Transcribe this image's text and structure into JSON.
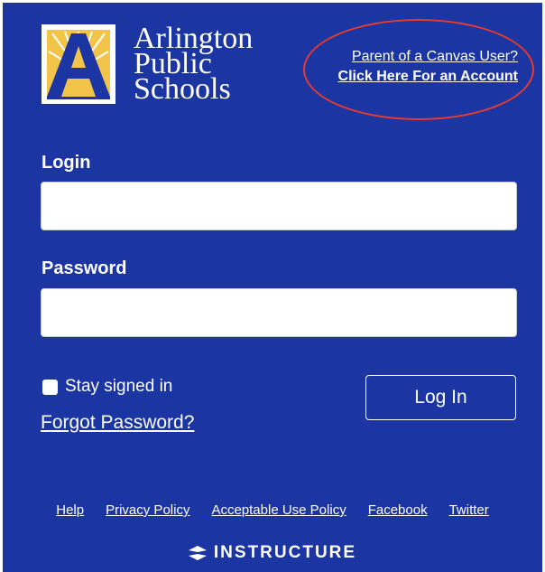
{
  "logo": {
    "line1": "Arlington",
    "line2": "Public",
    "line3": "Schools",
    "icon": "arlington-a-sunburst-logo",
    "colors": {
      "mark_yellow": "#f3c44a",
      "mark_blue": "#1b35a3"
    }
  },
  "parent": {
    "line1": "Parent of a Canvas User?",
    "line2": "Click Here For an Account",
    "highlight_color": "#e63a2e"
  },
  "form": {
    "login_label": "Login",
    "login_value": "",
    "password_label": "Password",
    "password_value": "",
    "stay_signed_in": "Stay signed in",
    "stay_signed_in_checked": false,
    "forgot_password": "Forgot Password?",
    "login_button": "Log In"
  },
  "footer": {
    "links": [
      "Help",
      "Privacy Policy",
      "Acceptable Use Policy",
      "Facebook",
      "Twitter"
    ],
    "brand": "INSTRUCTURE",
    "brand_icon": "instructure-icon"
  },
  "theme": {
    "background": "#1b35a3",
    "text": "#ffffff"
  }
}
